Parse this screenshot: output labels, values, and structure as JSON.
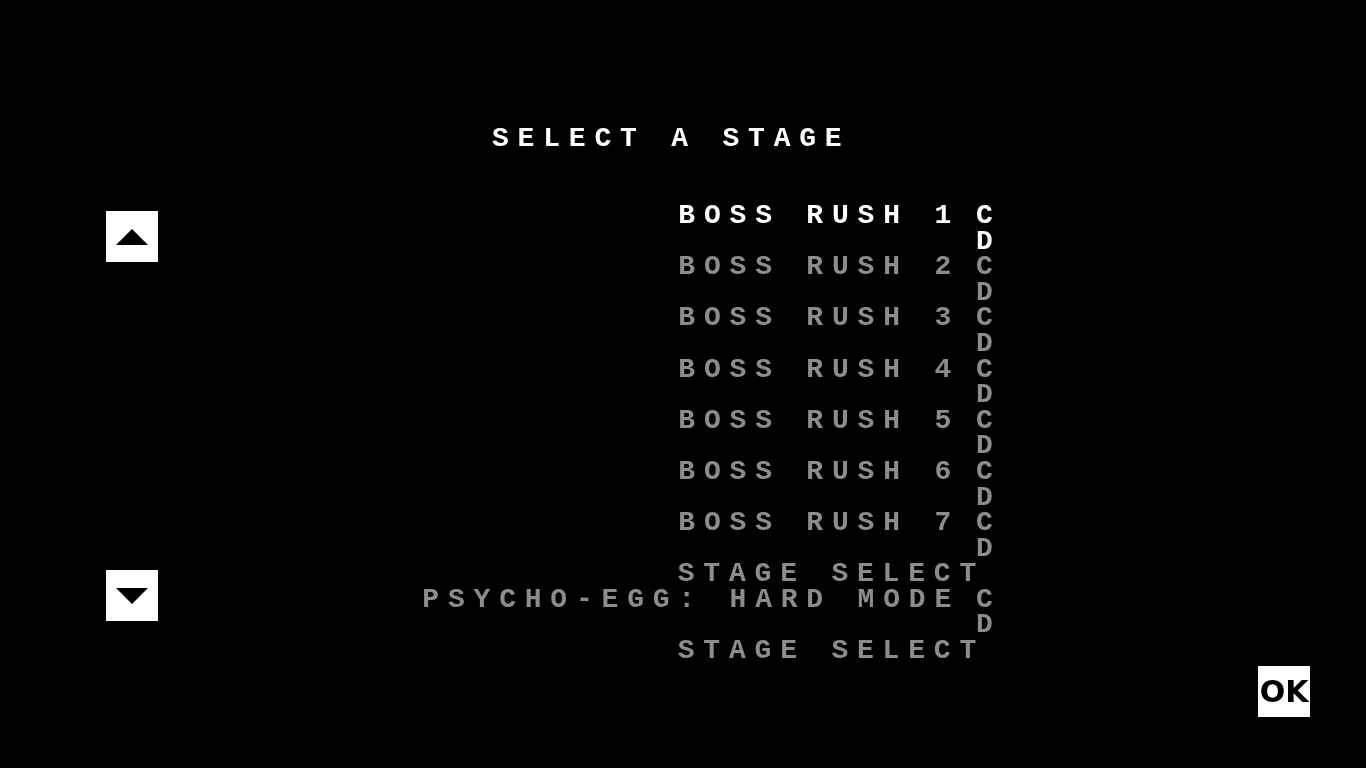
{
  "title": "SELECT A STAGE",
  "stages": [
    {
      "kind": "stage",
      "name": "BOSS RUSH 1",
      "code": "CD",
      "selected": true
    },
    {
      "kind": "stage",
      "name": "BOSS RUSH 2",
      "code": "CD",
      "selected": false
    },
    {
      "kind": "stage",
      "name": "BOSS RUSH 3",
      "code": "CD",
      "selected": false
    },
    {
      "kind": "stage",
      "name": "BOSS RUSH 4",
      "code": "CD",
      "selected": false
    },
    {
      "kind": "stage",
      "name": "BOSS RUSH 5",
      "code": "CD",
      "selected": false
    },
    {
      "kind": "stage",
      "name": "BOSS RUSH 6",
      "code": "CD",
      "selected": false
    },
    {
      "kind": "stage",
      "name": "BOSS RUSH 7",
      "code": "CD",
      "selected": false
    },
    {
      "kind": "framed",
      "above": "STAGE SELECT",
      "name": "PSYCHO-EGG: HARD MODE",
      "code": "CD",
      "below": "STAGE SELECT",
      "selected": false
    }
  ],
  "ok_button": {
    "label": "OK"
  }
}
